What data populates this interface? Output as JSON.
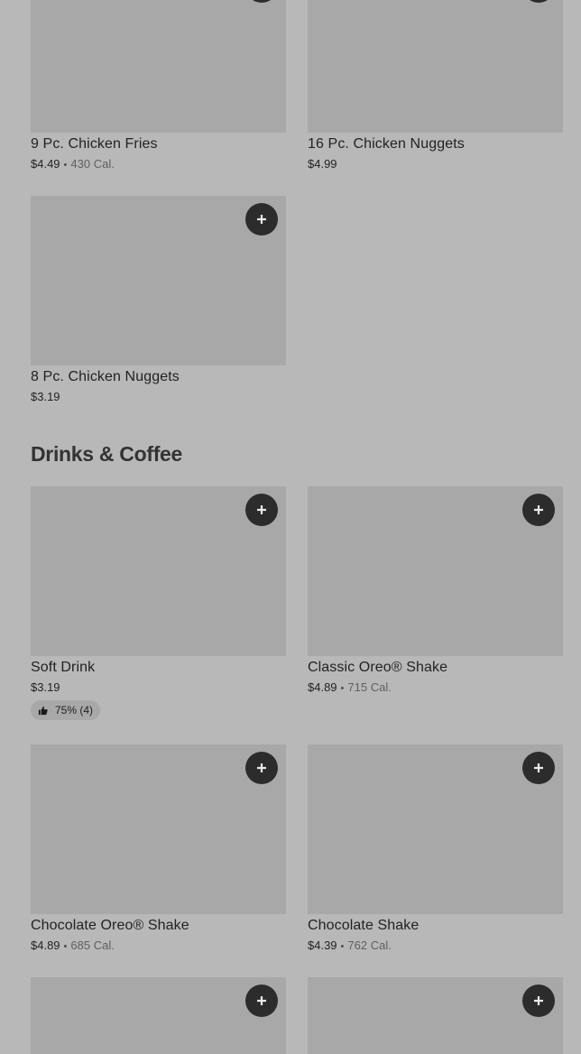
{
  "sections": [
    {
      "items": [
        {
          "name": "9 Pc. Chicken Fries",
          "price": "$4.49",
          "calories": "430 Cal."
        },
        {
          "name": "16 Pc. Chicken Nuggets",
          "price": "$4.99",
          "calories": ""
        },
        {
          "name": "8 Pc. Chicken Nuggets",
          "price": "$3.19",
          "calories": ""
        }
      ]
    },
    {
      "title": "Drinks & Coffee",
      "items": [
        {
          "name": "Soft Drink",
          "price": "$3.19",
          "calories": "",
          "rating": "75% (4)"
        },
        {
          "name": "Classic Oreo® Shake",
          "price": "$4.89",
          "calories": "715 Cal."
        },
        {
          "name": "Chocolate Oreo® Shake",
          "price": "$4.89",
          "calories": "685 Cal."
        },
        {
          "name": "Chocolate Shake",
          "price": "$4.39",
          "calories": "762 Cal."
        },
        {
          "name": "",
          "price": "",
          "calories": ""
        },
        {
          "name": "",
          "price": "",
          "calories": ""
        }
      ]
    }
  ],
  "separator": "•",
  "icons": {
    "add": "plus-icon",
    "rating": "thumbs-up-icon"
  },
  "colors": {
    "background": "#b8b8b8",
    "image_placeholder": "#a8a8a8",
    "add_button": "#2c2c2c"
  }
}
